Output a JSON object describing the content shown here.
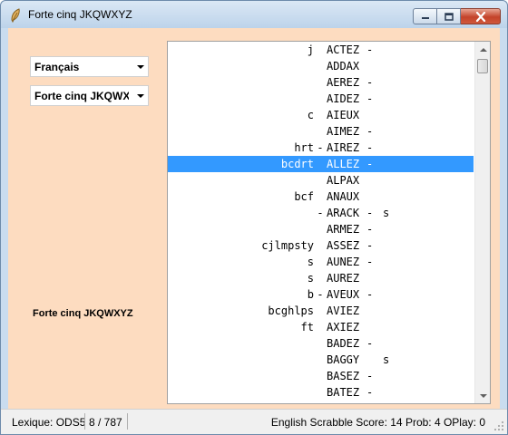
{
  "window": {
    "title": "Forte cinq JKQWXYZ",
    "app_icon": "feather-quill-icon",
    "minimize_icon": "minimize-icon",
    "maximize_icon": "maximize-icon",
    "close_icon": "close-icon"
  },
  "controls": {
    "language_select": "Français",
    "list_select": "Forte cinq JKQWXYZ",
    "side_label": "Forte cinq JKQWXYZ"
  },
  "list": {
    "selected_index": 7,
    "rows": [
      {
        "prefix": "j",
        "lhook": "",
        "word": "ACTEZ",
        "rhook": "-",
        "suffix": ""
      },
      {
        "prefix": "",
        "lhook": "",
        "word": "ADDAX",
        "rhook": "",
        "suffix": ""
      },
      {
        "prefix": "",
        "lhook": "",
        "word": "AEREZ",
        "rhook": "-",
        "suffix": ""
      },
      {
        "prefix": "",
        "lhook": "",
        "word": "AIDEZ",
        "rhook": "-",
        "suffix": ""
      },
      {
        "prefix": "c",
        "lhook": "",
        "word": "AIEUX",
        "rhook": "",
        "suffix": ""
      },
      {
        "prefix": "",
        "lhook": "",
        "word": "AIMEZ",
        "rhook": "-",
        "suffix": ""
      },
      {
        "prefix": "hrt",
        "lhook": "-",
        "word": "AIREZ",
        "rhook": "-",
        "suffix": ""
      },
      {
        "prefix": "bcdrt",
        "lhook": "",
        "word": "ALLEZ",
        "rhook": "-",
        "suffix": ""
      },
      {
        "prefix": "",
        "lhook": "",
        "word": "ALPAX",
        "rhook": "",
        "suffix": ""
      },
      {
        "prefix": "bcf",
        "lhook": "",
        "word": "ANAUX",
        "rhook": "",
        "suffix": ""
      },
      {
        "prefix": "",
        "lhook": "-",
        "word": "ARACK",
        "rhook": "-",
        "suffix": "s"
      },
      {
        "prefix": "",
        "lhook": "",
        "word": "ARMEZ",
        "rhook": "-",
        "suffix": ""
      },
      {
        "prefix": "cjlmpsty",
        "lhook": "",
        "word": "ASSEZ",
        "rhook": "-",
        "suffix": ""
      },
      {
        "prefix": "s",
        "lhook": "",
        "word": "AUNEZ",
        "rhook": "-",
        "suffix": ""
      },
      {
        "prefix": "s",
        "lhook": "",
        "word": "AUREZ",
        "rhook": "",
        "suffix": ""
      },
      {
        "prefix": "b",
        "lhook": "-",
        "word": "AVEUX",
        "rhook": "-",
        "suffix": ""
      },
      {
        "prefix": "bcghlps",
        "lhook": "",
        "word": "AVIEZ",
        "rhook": "",
        "suffix": ""
      },
      {
        "prefix": "ft",
        "lhook": "",
        "word": "AXIEZ",
        "rhook": "",
        "suffix": ""
      },
      {
        "prefix": "",
        "lhook": "",
        "word": "BADEZ",
        "rhook": "-",
        "suffix": ""
      },
      {
        "prefix": "",
        "lhook": "",
        "word": "BAGGY",
        "rhook": "",
        "suffix": "s"
      },
      {
        "prefix": "",
        "lhook": "",
        "word": "BASEZ",
        "rhook": "-",
        "suffix": ""
      },
      {
        "prefix": "",
        "lhook": "",
        "word": "BATEZ",
        "rhook": "-",
        "suffix": ""
      }
    ]
  },
  "status": {
    "lexique": "Lexique: ODS5",
    "count": "8 / 787",
    "score": "English Scrabble Score: 14 Prob:  4 OPlay:  0"
  },
  "colors": {
    "client_background": "#fddcc0",
    "selection": "#3399ff"
  }
}
